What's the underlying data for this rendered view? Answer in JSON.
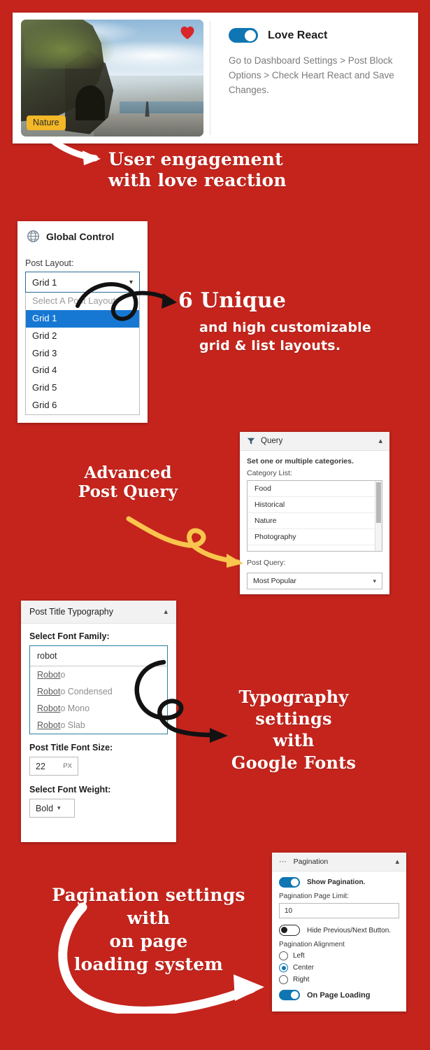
{
  "theme": {
    "background": "#c4241c",
    "accent_blue": "#1076b3",
    "select_highlight": "#1778d4",
    "tag_yellow": "#f3b827",
    "heart_red": "#d8262b",
    "arrow_white": "#ffffff",
    "arrow_yellow": "#f9c54d",
    "arrow_black": "#121212"
  },
  "love_react_panel": {
    "image": {
      "tag_label": "Nature",
      "heart_icon": "heart-icon",
      "alt": "coastal cliff with black sand beach and sea stack"
    },
    "toggle": {
      "state": "on",
      "label": "Love React"
    },
    "help_text": "Go to Dashboard Settings > Post Block Options > Check Heart React and Save Changes."
  },
  "annotation_1": {
    "line1": "User engagement",
    "line2": "with love reaction",
    "arrow": "white-arrow-down-right"
  },
  "global_control_panel": {
    "icon": "globe-icon",
    "title": "Global Control",
    "field_label": "Post Layout:",
    "selected_value": "Grid 1",
    "caret_icon": "chevron-down-icon",
    "options": [
      {
        "label": "Select A Post Layout",
        "state": "placeholder"
      },
      {
        "label": "Grid 1",
        "state": "selected"
      },
      {
        "label": "Grid 2",
        "state": "normal"
      },
      {
        "label": "Grid 3",
        "state": "normal"
      },
      {
        "label": "Grid 4",
        "state": "normal"
      },
      {
        "label": "Grid 5",
        "state": "normal"
      },
      {
        "label": "Grid 6",
        "state": "normal"
      }
    ]
  },
  "annotation_2": {
    "headline": "6 Unique",
    "line2": "and high customizable",
    "line3": "grid & list layouts.",
    "arrow": "black-curl-arrow-right"
  },
  "query_panel": {
    "icon": "filter-icon",
    "title": "Query",
    "collapse_icon": "chevron-up-icon",
    "note": "Set one or multiple categories.",
    "category_label": "Category List:",
    "categories": [
      "Food",
      "Historical",
      "Nature",
      "Photography"
    ],
    "post_query_label": "Post Query:",
    "post_query_value": "Most Popular",
    "caret_icon": "chevron-down-icon"
  },
  "annotation_3": {
    "line1": "Advanced",
    "line2": "Post Query",
    "arrow": "yellow-curl-arrow-down-right"
  },
  "typography_panel": {
    "title": "Post Title Typography",
    "collapse_icon": "chevron-up-icon",
    "font_family_label": "Select Font Family:",
    "font_family_query": "robot",
    "suggestions": [
      {
        "match": "Robot",
        "rest": "o"
      },
      {
        "match": "Robot",
        "rest": "o Condensed"
      },
      {
        "match": "Robot",
        "rest": "o Mono"
      },
      {
        "match": "Robot",
        "rest": "o Slab"
      }
    ],
    "font_size_label": "Post Title Font Size:",
    "font_size_value": "22",
    "font_size_unit": "PX",
    "font_weight_label": "Select Font Weight:",
    "font_weight_value": "Bold",
    "caret_icon": "chevron-down-icon"
  },
  "annotation_4": {
    "line1": "Typography",
    "line2": "settings",
    "line3": "with",
    "line4": "Google Fonts",
    "arrow": "black-arrow-right"
  },
  "pagination_panel": {
    "menu_icon": "ellipsis-icon",
    "title": "Pagination",
    "collapse_icon": "chevron-up-icon",
    "show_pagination": {
      "state": "on",
      "label": "Show Pagination."
    },
    "page_limit_label": "Pagination Page Limit:",
    "page_limit_value": "10",
    "hide_prev_next": {
      "state": "off",
      "label": "Hide Previous/Next Button."
    },
    "alignment_label": "Pagination Alignment",
    "alignment_options": [
      {
        "label": "Left",
        "state": "off"
      },
      {
        "label": "Center",
        "state": "on"
      },
      {
        "label": "Right",
        "state": "off"
      }
    ],
    "on_page_loading": {
      "state": "on",
      "label": "On Page Loading"
    }
  },
  "annotation_5": {
    "line1": "Pagination settings",
    "line2": "with",
    "line3": "on page",
    "line4": "loading system",
    "arrow": "white-curl-arrow-right"
  }
}
